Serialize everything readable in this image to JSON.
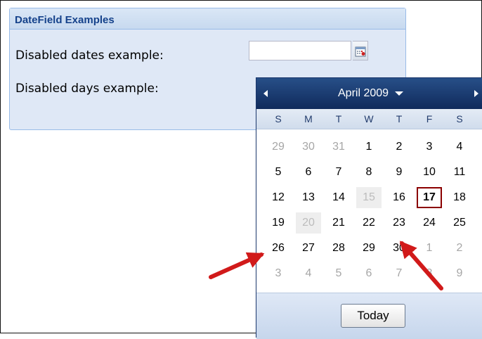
{
  "panel": {
    "title": "DateField Examples",
    "fields": [
      {
        "label": "Disabled dates example:",
        "value": ""
      },
      {
        "label": "Disabled days example:"
      }
    ]
  },
  "icons": {
    "trigger": "calendar-icon",
    "prev": "arrow-left-icon",
    "next": "arrow-right-icon",
    "month_menu": "caret-down-icon"
  },
  "picker": {
    "month_label": "April 2009",
    "days_of_week": [
      "S",
      "M",
      "T",
      "W",
      "T",
      "F",
      "S"
    ],
    "weeks": [
      [
        {
          "d": "29",
          "s": "other"
        },
        {
          "d": "30",
          "s": "other"
        },
        {
          "d": "31",
          "s": "other"
        },
        {
          "d": "1",
          "s": ""
        },
        {
          "d": "2",
          "s": ""
        },
        {
          "d": "3",
          "s": ""
        },
        {
          "d": "4",
          "s": ""
        }
      ],
      [
        {
          "d": "5",
          "s": ""
        },
        {
          "d": "6",
          "s": ""
        },
        {
          "d": "7",
          "s": ""
        },
        {
          "d": "8",
          "s": ""
        },
        {
          "d": "9",
          "s": ""
        },
        {
          "d": "10",
          "s": ""
        },
        {
          "d": "11",
          "s": ""
        }
      ],
      [
        {
          "d": "12",
          "s": ""
        },
        {
          "d": "13",
          "s": ""
        },
        {
          "d": "14",
          "s": ""
        },
        {
          "d": "15",
          "s": "disabled"
        },
        {
          "d": "16",
          "s": ""
        },
        {
          "d": "17",
          "s": "today"
        },
        {
          "d": "18",
          "s": ""
        }
      ],
      [
        {
          "d": "19",
          "s": ""
        },
        {
          "d": "20",
          "s": "disabled"
        },
        {
          "d": "21",
          "s": ""
        },
        {
          "d": "22",
          "s": ""
        },
        {
          "d": "23",
          "s": ""
        },
        {
          "d": "24",
          "s": ""
        },
        {
          "d": "25",
          "s": ""
        }
      ],
      [
        {
          "d": "26",
          "s": ""
        },
        {
          "d": "27",
          "s": ""
        },
        {
          "d": "28",
          "s": ""
        },
        {
          "d": "29",
          "s": ""
        },
        {
          "d": "30",
          "s": ""
        },
        {
          "d": "1",
          "s": "other"
        },
        {
          "d": "2",
          "s": "other"
        }
      ],
      [
        {
          "d": "3",
          "s": "other"
        },
        {
          "d": "4",
          "s": "other"
        },
        {
          "d": "5",
          "s": "other"
        },
        {
          "d": "6",
          "s": "other"
        },
        {
          "d": "7",
          "s": "other"
        },
        {
          "d": "8",
          "s": "other"
        },
        {
          "d": "9",
          "s": "other"
        }
      ]
    ],
    "today_label": "Today"
  },
  "colors": {
    "header_dark": "#102a5c",
    "panel_title": "#15428b",
    "today_border": "#8b0000",
    "annotation_arrow": "#d11a1a"
  }
}
